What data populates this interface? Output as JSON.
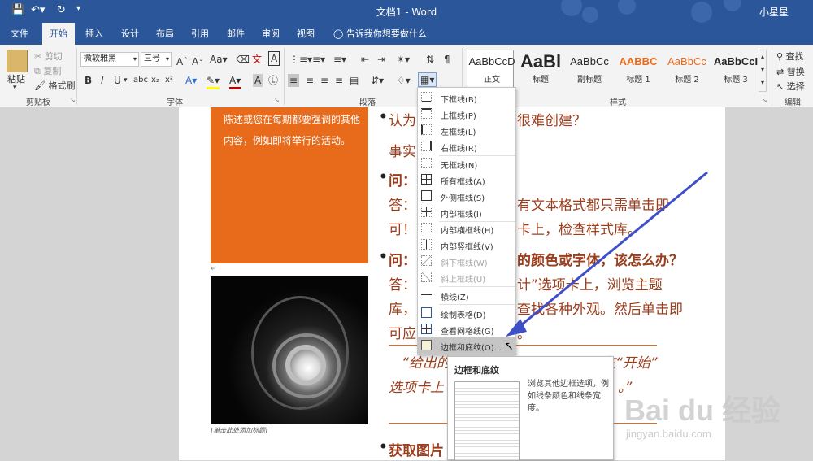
{
  "titlebar": {
    "save_icon": "save-icon",
    "undo_icon": "undo-icon",
    "redo_icon": "redo-icon",
    "title": "文档1 - Word",
    "user": "小星星"
  },
  "tabs": [
    "文件",
    "开始",
    "插入",
    "设计",
    "布局",
    "引用",
    "邮件",
    "审阅",
    "视图"
  ],
  "active_tab": "开始",
  "tell_me": "告诉我你想要做什么",
  "clipboard": {
    "paste": "粘贴",
    "cut": "剪切",
    "copy": "复制",
    "format_painter": "格式刷",
    "label": "剪贴板"
  },
  "font": {
    "family": "微软雅黑",
    "size": "三号",
    "label": "字体",
    "buttons": [
      "B",
      "I",
      "U",
      "abc",
      "x₂",
      "x²"
    ]
  },
  "paragraph": {
    "label": "段落"
  },
  "styles": {
    "label": "样式",
    "items": [
      {
        "preview": "AaBbCcD",
        "name": "正文",
        "color": "#262626"
      },
      {
        "preview": "AaBl",
        "name": "标题",
        "color": "#262626"
      },
      {
        "preview": "AaBbCc",
        "name": "副标题",
        "color": "#262626"
      },
      {
        "preview": "AABBC",
        "name": "标题 1",
        "color": "#e86a1b"
      },
      {
        "preview": "AaBbCc",
        "name": "标题 2",
        "color": "#e86a1b"
      },
      {
        "preview": "AaBbCcI",
        "name": "标题 3",
        "color": "#262626"
      }
    ]
  },
  "editing": {
    "find": "查找",
    "replace": "替换",
    "select": "选择",
    "label": "编辑"
  },
  "document": {
    "orange_text": "陈述或您在每期都要强调的其他内容，例如即将举行的活动。",
    "caption": "[单击此处添加标题]",
    "lines": [
      "认为",
      "很难创建？",
      "事实",
      "问：",
      "答：",
      "有文本格式都只需单击即",
      "可！",
      "卡上，检查样式库。",
      "问：",
      "的颜色或字体，该怎么办？",
      "答：",
      "计”选项卡上，浏览主题",
      "库，",
      "查找各种外观。然后单击即",
      "可应",
      "。",
      "“给出的",
      "在“开始”",
      "选项卡上",
      "。”",
      "获取图片"
    ]
  },
  "menu": {
    "items": [
      {
        "label": "下框线(B)",
        "disabled": false
      },
      {
        "label": "上框线(P)",
        "disabled": false
      },
      {
        "label": "左框线(L)",
        "disabled": false
      },
      {
        "label": "右框线(R)",
        "disabled": false
      },
      {
        "label": "无框线(N)",
        "disabled": false
      },
      {
        "label": "所有框线(A)",
        "disabled": false
      },
      {
        "label": "外侧框线(S)",
        "disabled": false
      },
      {
        "label": "内部框线(I)",
        "disabled": false
      },
      {
        "label": "内部横框线(H)",
        "disabled": false
      },
      {
        "label": "内部竖框线(V)",
        "disabled": false
      },
      {
        "label": "斜下框线(W)",
        "disabled": true
      },
      {
        "label": "斜上框线(U)",
        "disabled": true
      },
      {
        "label": "横线(Z)",
        "disabled": false
      },
      {
        "label": "绘制表格(D)",
        "disabled": false
      },
      {
        "label": "查看网格线(G)",
        "disabled": false
      },
      {
        "label": "边框和底纹(O)...",
        "disabled": false
      }
    ],
    "highlighted": "边框和底纹(O)..."
  },
  "tooltip": {
    "title": "边框和底纹",
    "desc": "浏览其他边框选项，例如线条颜色和线条宽度。"
  },
  "watermark": {
    "main": "Bai du 经验",
    "sub": "jingyan.baidu.com"
  },
  "colors": {
    "brand": "#2b579a",
    "accent": "#e86a1b",
    "text": "#9c3d1c",
    "arrow": "#3f4fc8"
  }
}
